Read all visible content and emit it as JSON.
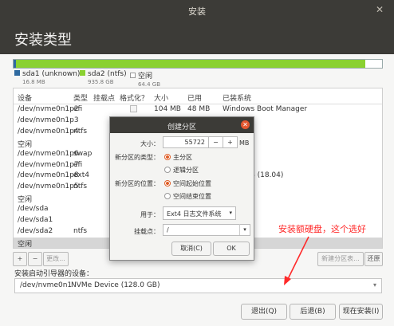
{
  "window": {
    "title": "安装",
    "close_glyph": "✕"
  },
  "page": {
    "title": "安装类型"
  },
  "disk_bar": {
    "used_fraction": 0.955,
    "colors": {
      "sda1": "#2f6aa0",
      "sda2": "#8ad131",
      "free": "#ffffff"
    }
  },
  "legend": [
    {
      "name": "sda1 (unknown)",
      "size": "16.8 MB",
      "color": "#2f6aa0"
    },
    {
      "name": "sda2 (ntfs)",
      "size": "935.8 GB",
      "color": "#8ad131"
    },
    {
      "name": "空闲",
      "size": "64.4 GB",
      "color": "#ffffff"
    }
  ],
  "table": {
    "headers": [
      "设备",
      "类型",
      "挂载点",
      "格式化？",
      "大小",
      "已用",
      "已装系统"
    ],
    "rows": [
      {
        "device": "/dev/nvme0n1p2",
        "type": "efi",
        "mount": "",
        "format": false,
        "size": "104 MB",
        "used": "48 MB",
        "system": "Windows Boot Manager"
      },
      {
        "device": "/dev/nvme0n1p3",
        "type": "",
        "mount": "",
        "format": null,
        "size": "",
        "used": "",
        "system": ""
      },
      {
        "device": "/dev/nvme0n1p4",
        "type": "ntfs",
        "mount": "",
        "format": null,
        "size": "",
        "used": "",
        "system": ""
      },
      {
        "device": "空闲",
        "type": "",
        "mount": "",
        "format": null,
        "size": "",
        "used": "",
        "system": ""
      },
      {
        "device": "/dev/nvme0n1p6",
        "type": "swap",
        "mount": "",
        "format": null,
        "size": "",
        "used": "",
        "system": ""
      },
      {
        "device": "/dev/nvme0n1p7",
        "type": "efi",
        "mount": "",
        "format": null,
        "size": "",
        "used": "",
        "system": ""
      },
      {
        "device": "/dev/nvme0n1p8",
        "type": "ext4",
        "mount": "",
        "format": null,
        "size": "",
        "used": "",
        "system": ".04.1 LTS (18.04)"
      },
      {
        "device": "/dev/nvme0n1p5",
        "type": "ntfs",
        "mount": "",
        "format": null,
        "size": "",
        "used": "",
        "system": ""
      },
      {
        "device": "空闲",
        "type": "",
        "mount": "",
        "format": null,
        "size": "",
        "used": "",
        "system": ""
      },
      {
        "device": "/dev/sda",
        "type": "",
        "mount": "",
        "format": null,
        "size": "",
        "used": "",
        "system": ""
      },
      {
        "device": "/dev/sda1",
        "type": "",
        "mount": "",
        "format": null,
        "size": "",
        "used": "",
        "system": ""
      },
      {
        "device": "/dev/sda2",
        "type": "ntfs",
        "mount": "",
        "format": null,
        "size": "",
        "used": "",
        "system": ""
      },
      {
        "device": "空闲",
        "type": "",
        "mount": "",
        "format": null,
        "size": "",
        "used": "",
        "system": ""
      }
    ],
    "selected_row": 12
  },
  "table_buttons": {
    "add": "+",
    "remove": "−",
    "change": "更改...",
    "new_table": "新建分区表...",
    "revert": "还原"
  },
  "bootloader": {
    "label": "安装启动引导器的设备：",
    "device": "/dev/nvme0n1",
    "desc": "NVMe Device (128.0 GB)",
    "arrow": "▾"
  },
  "buttons": {
    "quit": "退出(Q)",
    "back": "后退(B)",
    "install": "现在安装(I)"
  },
  "dialog": {
    "title": "创建分区",
    "close_glyph": "✕",
    "size_label": "大小：",
    "size_value": "55722",
    "size_unit": "MB",
    "minus": "−",
    "plus": "+",
    "type_label": "新分区的类型：",
    "type_options": [
      "主分区",
      "逻辑分区"
    ],
    "type_selected": 0,
    "location_label": "新分区的位置：",
    "location_options": [
      "空间起始位置",
      "空间结束位置"
    ],
    "location_selected": 0,
    "use_label": "用于：",
    "use_value": "Ext4 日志文件系统",
    "mount_label": "挂载点：",
    "mount_value": "/",
    "cancel": "取消(C)",
    "ok": "OK"
  },
  "annotation": {
    "text": "安装额硬盘，这个选好",
    "color": "#ff2a2a"
  }
}
